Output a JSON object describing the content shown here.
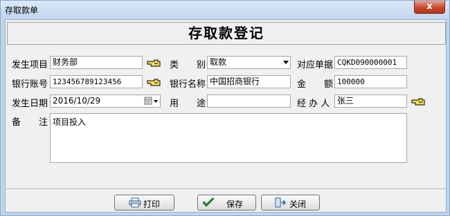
{
  "window": {
    "title": "存取款单",
    "close_glyph": "x"
  },
  "form": {
    "title": "存取款登记",
    "rows": {
      "occurrence_item": {
        "label": "发生项目",
        "value": "财务部"
      },
      "category": {
        "label": "类　　别",
        "value": "取款"
      },
      "voucher": {
        "label": "对应单据",
        "value": "CQKD090000001"
      },
      "bank_account": {
        "label": "银行账号",
        "value": "123456789123456"
      },
      "bank_name": {
        "label": "银行名称",
        "value": "中国招商银行"
      },
      "amount": {
        "label": "金　　额",
        "value": "100000"
      },
      "date": {
        "label": "发生日期",
        "value": "2016/10/29"
      },
      "purpose": {
        "label": "用　　途",
        "value": ""
      },
      "handler": {
        "label": "经 办 人",
        "value": "张三"
      },
      "remark": {
        "label": "备　　注",
        "value": "项目投入"
      }
    }
  },
  "buttons": {
    "print": "打印",
    "save": "保存",
    "close": "关闭"
  },
  "icons": {
    "picker": "hand-pointer-icon",
    "calendar": "calendar-icon",
    "print": "printer-icon",
    "save": "checkmark-icon",
    "close": "exit-door-icon"
  }
}
